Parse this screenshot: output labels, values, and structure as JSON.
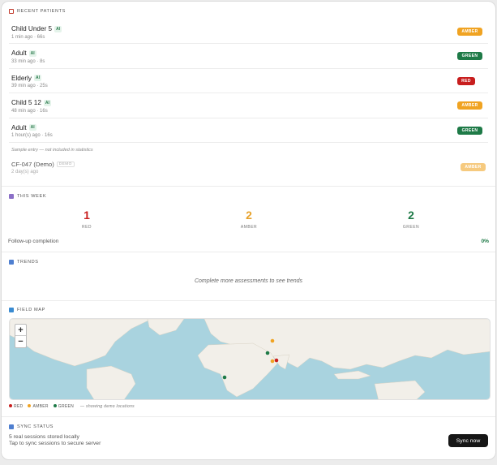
{
  "recent": {
    "title": "RECENT PATIENTS",
    "ai_label": "AI",
    "rows": [
      {
        "name": "Child Under 5",
        "meta": "1 min ago · 66s",
        "status": "AMBER"
      },
      {
        "name": "Adult",
        "meta": "33 min ago · 8s",
        "status": "GREEN"
      },
      {
        "name": "Elderly",
        "meta": "39 min ago · 25s",
        "status": "RED"
      },
      {
        "name": "Child 5 12",
        "meta": "48 min ago · 16s",
        "status": "AMBER"
      },
      {
        "name": "Adult",
        "meta": "1 hour(s) ago · 16s",
        "status": "GREEN"
      }
    ],
    "sample_note": "Sample entry — not included in statistics",
    "demo": {
      "name": "CF-047 (Demo)",
      "tag": "DEMO",
      "meta": "2 day(s) ago",
      "status": "AMBER"
    }
  },
  "week": {
    "title": "THIS WEEK",
    "stats": [
      {
        "value": "1",
        "label": "RED",
        "color": "#c81e1e"
      },
      {
        "value": "2",
        "label": "AMBER",
        "color": "#e7a12a"
      },
      {
        "value": "2",
        "label": "GREEN",
        "color": "#1e7a47"
      }
    ],
    "followup_label": "Follow-up completion",
    "followup_value": "0%"
  },
  "trends": {
    "title": "TRENDS",
    "empty": "Complete more assessments to see trends"
  },
  "map": {
    "title": "FIELD MAP",
    "zoom_in": "+",
    "zoom_out": "−",
    "legend": {
      "red": "RED",
      "amber": "AMBER",
      "green": "GREEN",
      "note": "— showing demo locations"
    },
    "colors": {
      "red": "#c81e1e",
      "amber": "#f0a322",
      "green": "#1e7a47",
      "water": "#a9d3df",
      "land": "#f2efe9"
    }
  },
  "sync": {
    "title": "SYNC STATUS",
    "line1": "5 real sessions stored locally",
    "line2": "Tap to sync sessions to secure server",
    "button": "Sync now"
  }
}
